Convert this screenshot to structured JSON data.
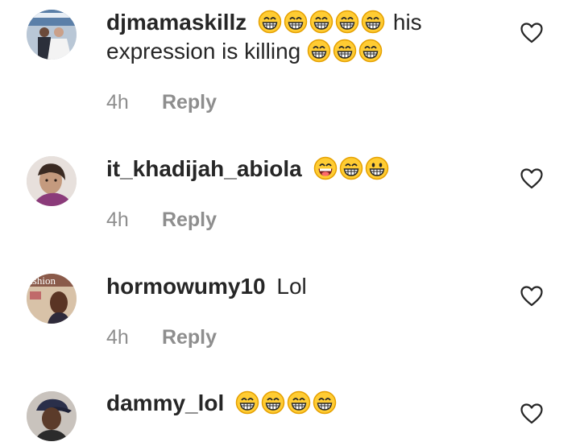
{
  "comments": [
    {
      "username": "djmamaskillz",
      "text_before": "",
      "emojis_mid": 5,
      "text": "his expression is killing",
      "emojis_end": 3,
      "time": "4h",
      "reply": "Reply",
      "avatar_icon": "wedding-photo-avatar",
      "like_icon": "heart-outline-icon"
    },
    {
      "username": "it_khadijah_abiola",
      "text": "",
      "emojis": [
        "grin-tongue",
        "grin",
        "grin"
      ],
      "time": "4h",
      "reply": "Reply",
      "avatar_icon": "woman-portrait-avatar",
      "like_icon": "heart-outline-icon"
    },
    {
      "username": "hormowumy10",
      "text": "Lol",
      "avatar_text": "ashion",
      "time": "4h",
      "reply": "Reply",
      "avatar_icon": "fashion-magazine-avatar",
      "like_icon": "heart-outline-icon"
    },
    {
      "username": "dammy_lol",
      "text": "",
      "emojis_count": 4,
      "avatar_icon": "woman-cap-avatar",
      "like_icon": "heart-outline-icon"
    }
  ],
  "colors": {
    "text": "#262626",
    "meta": "#8e8e8e",
    "emoji_face": "#ffcc33",
    "emoji_outline": "#e5a000"
  }
}
